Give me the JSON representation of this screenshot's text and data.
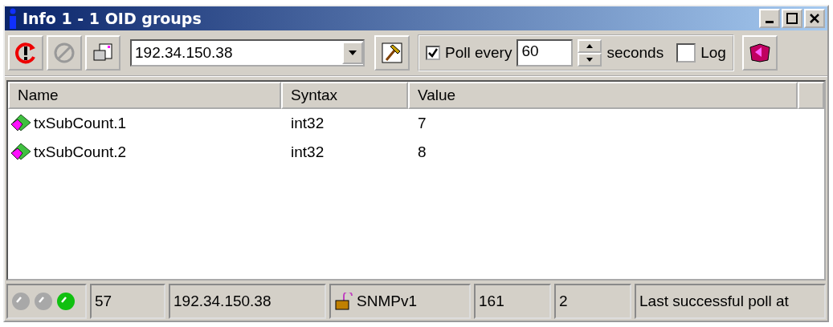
{
  "window": {
    "title": "Info 1  -  1 OID groups"
  },
  "toolbar": {
    "address": "192.34.150.38",
    "poll": {
      "label": "Poll every",
      "checked": true
    },
    "interval": "60",
    "unit": "seconds",
    "log": {
      "label": "Log",
      "checked": false
    }
  },
  "table": {
    "columns": [
      "Name",
      "Syntax",
      "Value"
    ],
    "rows": [
      {
        "name": "txSubCount.1",
        "syntax": "int32",
        "value": "7"
      },
      {
        "name": "txSubCount.2",
        "syntax": "int32",
        "value": "8"
      }
    ]
  },
  "status_bar": {
    "lights": [
      {
        "color": "#a8a8a8"
      },
      {
        "color": "#a8a8a8"
      },
      {
        "color": "#10c010"
      }
    ],
    "count": "57",
    "address": "192.34.150.38",
    "version": "SNMPv1",
    "port": "161",
    "retries": "2",
    "message": "Last successful poll at"
  }
}
